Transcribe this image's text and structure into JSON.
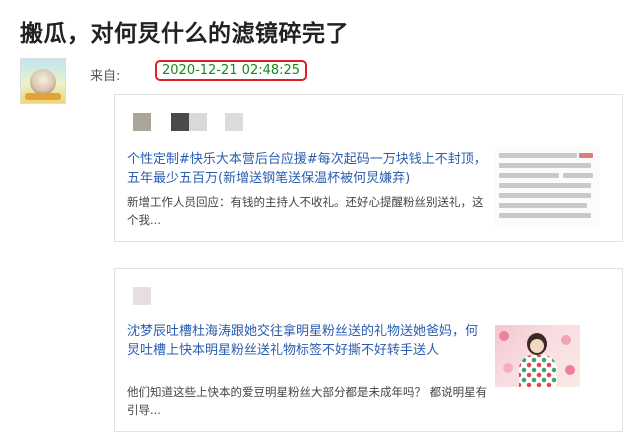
{
  "post": {
    "title": "搬瓜，对何炅什么的滤镜碎完了",
    "from_label": "来自:",
    "timestamp": "2020-12-21 02:48:25"
  },
  "cards": [
    {
      "title": "个性定制#快乐大本营后台应援#每次起码一万块钱上不封顶，五年最少五百万(新增送钢笔送保温杯被何炅嫌弃)",
      "desc": "新增工作人员回应：有钱的主持人不收礼。还好心提醒粉丝别送礼，这个我..."
    },
    {
      "title": "沈梦辰吐槽杜海涛跟她交往拿明星粉丝送的礼物送她爸妈，何炅吐槽上快本明星粉丝送礼物标签不好撕不好转手送人",
      "desc": "他们知道这些上快本的爱豆明星粉丝大部分都是未成年吗？ 都说明星有引导..."
    }
  ],
  "colors": {
    "link": "#2a5db0",
    "timestamp_text": "#138a1c",
    "timestamp_border": "#e02020"
  }
}
